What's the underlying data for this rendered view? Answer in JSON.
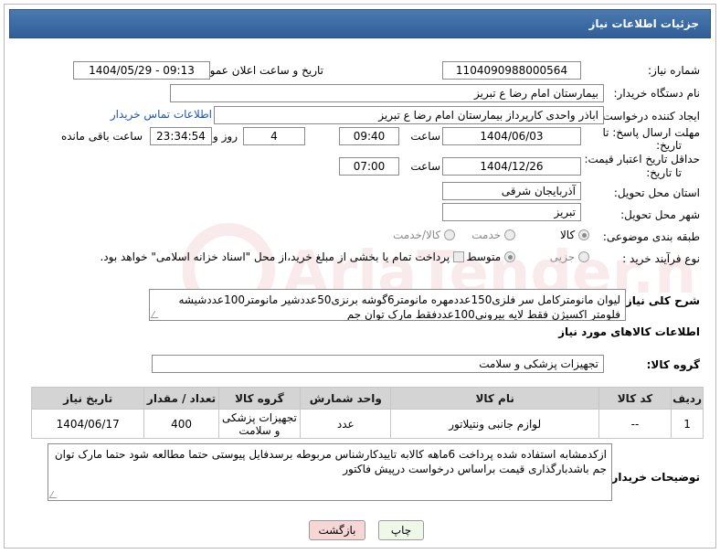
{
  "header": {
    "title": "جزئیات اطلاعات نیاز"
  },
  "fields": {
    "need_number_label": "شماره نیاز:",
    "need_number": "1104090988000564",
    "announce_label": "تاریخ و ساعت اعلان عمومی:",
    "announce_value": "1404/05/29 - 09:13",
    "buyer_org_label": "نام دستگاه خریدار:",
    "buyer_org": "بیمارستان امام رضا  ع  تبریز",
    "creator_label": "ایجاد کننده درخواست:",
    "creator": "اباذر واحدی کارپرداز بیمارستان امام رضا  ع  تبریز",
    "contact_link": "اطلاعات تماس خریدار",
    "deadline_label_1": "مهلت ارسال پاسخ: تا",
    "deadline_label_2": "تاریخ:",
    "deadline_date": "1404/06/03",
    "time_label": "ساعت",
    "deadline_time": "09:40",
    "days_value": "4",
    "days_label": "روز و",
    "remaining_value": "23:34:54",
    "remaining_label": "ساعت باقی مانده",
    "validity_label_1": "حداقل تاریخ اعتبار قیمت:",
    "validity_label_2": "تا تاریخ:",
    "validity_date": "1404/12/26",
    "validity_time": "07:00",
    "province_label": "استان محل تحویل:",
    "province": "آذربایجان شرقی",
    "city_label": "شهر محل تحویل:",
    "city": "تبریز",
    "category_label": "طبقه بندی موضوعی:",
    "category_options": [
      "کالا",
      "خدمت",
      "کالا/خدمت"
    ],
    "process_label": "نوع فرآیند خرید :",
    "process_options": [
      "جزیی",
      "متوسط"
    ],
    "payment_note": "پرداخت تمام یا بخشی از مبلغ خرید،از محل \"اسناد خزانه اسلامی\" خواهد بود."
  },
  "description": {
    "label": "شرح کلی نیاز:",
    "text": "لیوان مانومترکامل سر فلزی150عددمهره مانومتر6گوشه برنزی50عددشیر مانومتر100عددشیشه فلومتر اکسیژن فقط لایه بیرونی100عددفقط مارک توان جم"
  },
  "goods": {
    "section_title": "اطلاعات کالاهای مورد نیاز",
    "group_label": "گروه کالا:",
    "group_value": "تجهیزات پزشکی و سلامت",
    "columns": [
      "ردیف",
      "کد کالا",
      "نام کالا",
      "واحد شمارش",
      "گروه کالا",
      "تعداد / مقدار",
      "تاریخ نیاز"
    ],
    "rows": [
      {
        "row": "1",
        "code": "--",
        "name": "لوازم جانبی ونتیلاتور",
        "unit": "عدد",
        "group": "تجهیزات پزشکی و سلامت",
        "qty": "400",
        "date": "1404/06/17"
      }
    ]
  },
  "buyer_notes": {
    "label": "توضیحات خریدار:",
    "text": "ازکدمشابه استفاده شده پرداخت 6ماهه کالابه تاییدکارشناس مربوطه برسدفایل پیوستی حتما مطالعه شود حتما مارک توان جم باشدبارگذاری قیمت براساس درخواست درپیش فاکتور"
  },
  "buttons": {
    "print": "چاپ",
    "back": "بازگشت"
  },
  "watermark_text": "AriaTender.neT",
  "colors": {
    "title_bar": "#3a6aa3",
    "link": "#1a55b5",
    "back_button": "#f7d6d6",
    "print_button": "#eef7e8"
  }
}
